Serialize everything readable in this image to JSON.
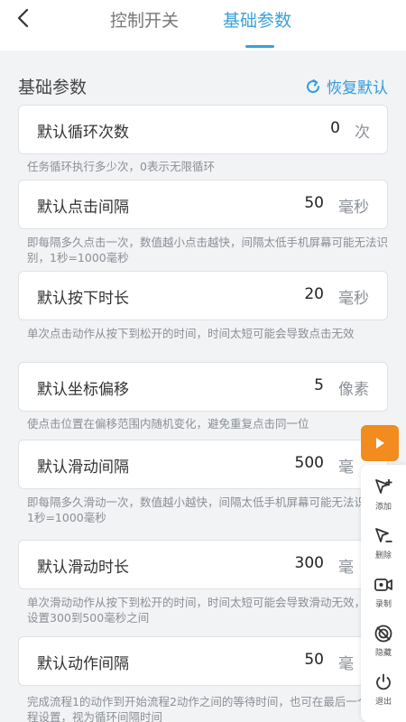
{
  "header": {
    "tabs": [
      {
        "label": "控制开关"
      },
      {
        "label": "基础参数"
      }
    ]
  },
  "section": {
    "title": "基础参数",
    "reset_label": "恢复默认"
  },
  "settings": [
    {
      "label": "默认循环次数",
      "value": "0",
      "unit": "次",
      "hint": "任务循环执行多少次，0表示无限循环"
    },
    {
      "label": "默认点击间隔",
      "value": "50",
      "unit": "毫秒",
      "hint": "即每隔多久点击一次，数值越小点击越快，间隔太低手机屏幕可能无法识别，1秒=1000毫秒"
    },
    {
      "label": "默认按下时长",
      "value": "20",
      "unit": "毫秒",
      "hint": "单次点击动作从按下到松开的时间，时间太短可能会导致点击无效"
    },
    {
      "label": "默认坐标偏移",
      "value": "5",
      "unit": "像素",
      "hint": "使点击位置在偏移范围内随机变化，避免重复点击同一位"
    },
    {
      "label": "默认滑动间隔",
      "value": "500",
      "unit": "毫",
      "hint": "即每隔多久滑动一次，数值越小越快，间隔太低手机屏幕可能无法识别，1秒=1000毫秒"
    },
    {
      "label": "默认滑动时长",
      "value": "300",
      "unit": "毫",
      "hint": "单次滑动动作从按下到松开的时间，时间太短可能会导致滑动无效，建议设置300到500毫秒之间"
    },
    {
      "label": "默认动作间隔",
      "value": "50",
      "unit": "毫",
      "hint": "完成流程1的动作到开始流程2动作之间的等待时间，也可在最后一个流程设置，视为循环间隔时间"
    }
  ],
  "toolbar": {
    "items": [
      {
        "label": "添加",
        "icon": "add-cursor-icon"
      },
      {
        "label": "删除",
        "icon": "delete-cursor-icon"
      },
      {
        "label": "录制",
        "icon": "record-icon"
      },
      {
        "label": "隐藏",
        "icon": "hide-icon"
      },
      {
        "label": "退出",
        "icon": "power-icon"
      }
    ]
  },
  "colors": {
    "accent": "#3aa0d8",
    "play_button": "#f28c1e"
  }
}
